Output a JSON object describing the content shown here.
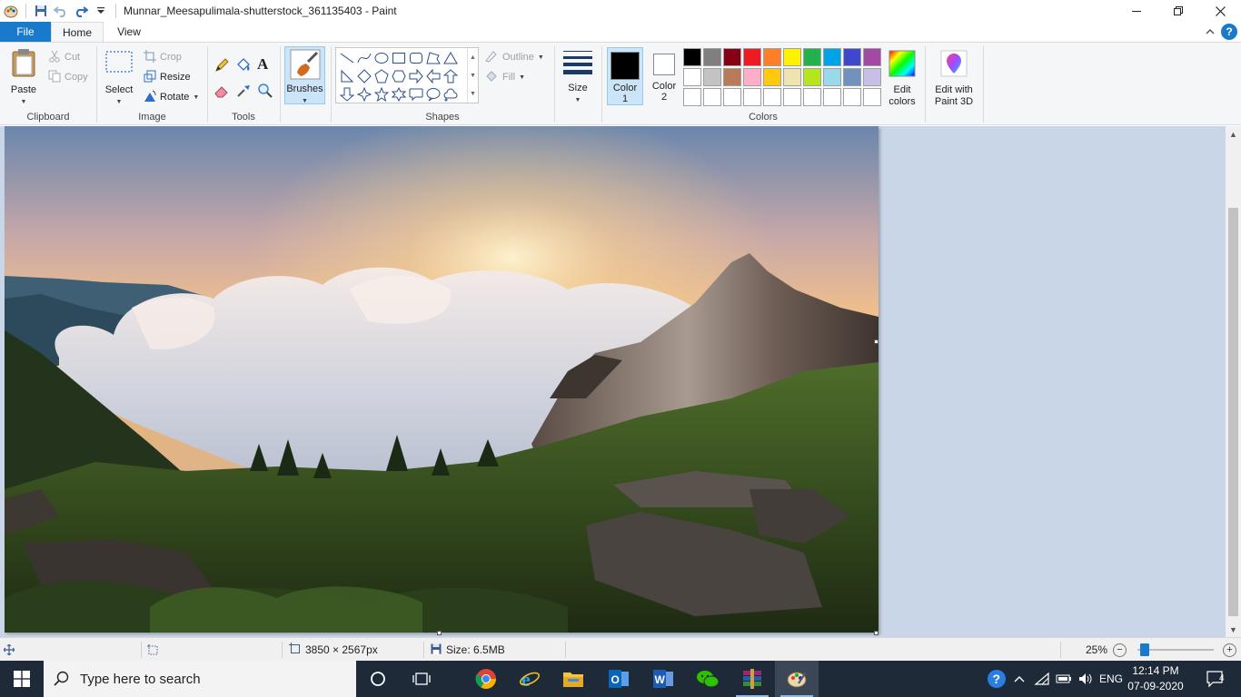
{
  "window": {
    "title": "Munnar_Meesapulimala-shutterstock_361135403 - Paint"
  },
  "tabs": [
    {
      "label": "File"
    },
    {
      "label": "Home"
    },
    {
      "label": "View"
    }
  ],
  "ribbon": {
    "clipboard": {
      "label": "Clipboard",
      "paste": "Paste",
      "cut": "Cut",
      "copy": "Copy"
    },
    "image": {
      "label": "Image",
      "select": "Select",
      "crop": "Crop",
      "resize": "Resize",
      "rotate": "Rotate"
    },
    "tools": {
      "label": "Tools"
    },
    "brushes": {
      "label": "Brushes"
    },
    "shapes": {
      "label": "Shapes",
      "outline": "Outline",
      "fill": "Fill"
    },
    "size": {
      "label": "Size"
    },
    "colors": {
      "label": "Colors",
      "color1_line1": "Color",
      "color1_line2": "1",
      "color2_line1": "Color",
      "color2_line2": "2",
      "color1_value": "#000000",
      "color2_value": "#ffffff",
      "edit_line1": "Edit",
      "edit_line2": "colors",
      "palette_row1": [
        "#000000",
        "#7f7f7f",
        "#880015",
        "#ed1c24",
        "#ff7f27",
        "#fff200",
        "#22b14c",
        "#00a2e8",
        "#3f48cc",
        "#a349a4"
      ],
      "palette_row2": [
        "#ffffff",
        "#c3c3c3",
        "#b97a57",
        "#ffaec9",
        "#ffc90e",
        "#efe4b0",
        "#b5e61d",
        "#99d9ea",
        "#7092be",
        "#c8bfe7"
      ],
      "palette_row3": [
        "#ffffff",
        "#ffffff",
        "#ffffff",
        "#ffffff",
        "#ffffff",
        "#ffffff",
        "#ffffff",
        "#ffffff",
        "#ffffff",
        "#ffffff"
      ]
    },
    "paint3d": {
      "line1": "Edit with",
      "line2": "Paint 3D"
    }
  },
  "status": {
    "dimensions": "3850 × 2567px",
    "size": "Size: 6.5MB",
    "zoom": "25%",
    "zoom_out": "−",
    "zoom_in": "+"
  },
  "taskbar": {
    "search_placeholder": "Type here to search",
    "language": "ENG",
    "time": "12:14 PM",
    "date": "07-09-2020",
    "notifications": "4"
  }
}
